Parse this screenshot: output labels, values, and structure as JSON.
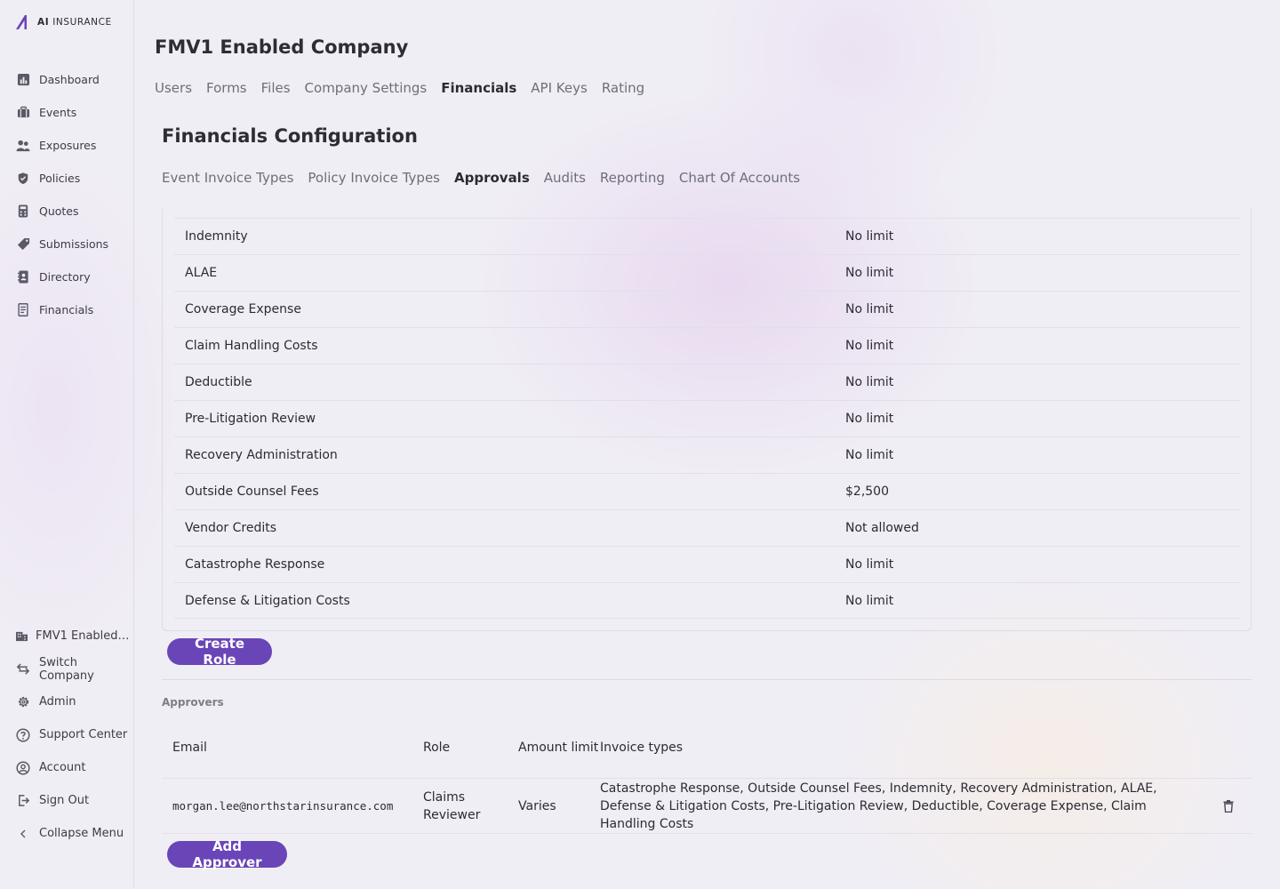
{
  "brand": {
    "logo_prefix": "AI",
    "logo_suffix": "INSURANCE"
  },
  "sidebar": {
    "items": [
      {
        "label": "Dashboard",
        "icon": "chart-icon"
      },
      {
        "label": "Events",
        "icon": "briefcase-icon"
      },
      {
        "label": "Exposures",
        "icon": "people-icon"
      },
      {
        "label": "Policies",
        "icon": "shield-icon"
      },
      {
        "label": "Quotes",
        "icon": "calculator-icon"
      },
      {
        "label": "Submissions",
        "icon": "tag-icon"
      },
      {
        "label": "Directory",
        "icon": "contact-book-icon"
      },
      {
        "label": "Financials",
        "icon": "receipt-icon"
      }
    ],
    "bottom": [
      {
        "label": "FMV1 Enabled Company",
        "icon": "building-icon"
      },
      {
        "label": "Switch Company",
        "icon": "switch-arrows-icon"
      },
      {
        "label": "Admin",
        "icon": "gear-icon"
      },
      {
        "label": "Support Center",
        "icon": "help-icon"
      },
      {
        "label": "Account",
        "icon": "user-circle-icon"
      },
      {
        "label": "Sign Out",
        "icon": "sign-out-icon"
      },
      {
        "label": "Collapse Menu",
        "icon": "chevron-left-icon"
      }
    ]
  },
  "header": {
    "company": "FMV1 Enabled Company",
    "tabs": [
      "Users",
      "Forms",
      "Files",
      "Company Settings",
      "Financials",
      "API Keys",
      "Rating"
    ],
    "active_tab": "Financials"
  },
  "section": {
    "title": "Financials Configuration",
    "tabs": [
      "Event Invoice Types",
      "Policy Invoice Types",
      "Approvals",
      "Audits",
      "Reporting",
      "Chart Of Accounts"
    ],
    "active_tab": "Approvals"
  },
  "limits": [
    {
      "name": "Indemnity",
      "value": "No limit"
    },
    {
      "name": "ALAE",
      "value": "No limit"
    },
    {
      "name": "Coverage Expense",
      "value": "No limit"
    },
    {
      "name": "Claim Handling Costs",
      "value": "No limit"
    },
    {
      "name": "Deductible",
      "value": "No limit"
    },
    {
      "name": "Pre-Litigation Review",
      "value": "No limit"
    },
    {
      "name": "Recovery Administration",
      "value": "No limit"
    },
    {
      "name": "Outside Counsel Fees",
      "value": "$2,500"
    },
    {
      "name": "Vendor Credits",
      "value": "Not allowed"
    },
    {
      "name": "Catastrophe Response",
      "value": "No limit"
    },
    {
      "name": "Defense & Litigation Costs",
      "value": "No limit"
    }
  ],
  "buttons": {
    "create_role": "Create Role",
    "add_approver": "Add Approver"
  },
  "approvers": {
    "label": "Approvers",
    "headers": {
      "email": "Email",
      "role": "Role",
      "amount": "Amount limit",
      "types": "Invoice types"
    },
    "rows": [
      {
        "email": "morgan.lee@northstarinsurance.com",
        "role": "Claims Reviewer",
        "amount": "Varies",
        "types": "Catastrophe Response, Outside Counsel Fees, Indemnity, Recovery Administration, ALAE, Defense & Litigation Costs, Pre-Litigation Review, Deductible, Coverage Expense, Claim Handling Costs"
      }
    ]
  },
  "colors": {
    "accent": "#6a45b8",
    "background": "#f0eef5",
    "border": "#e2dfe8",
    "muted_text": "#6e6e7a"
  }
}
